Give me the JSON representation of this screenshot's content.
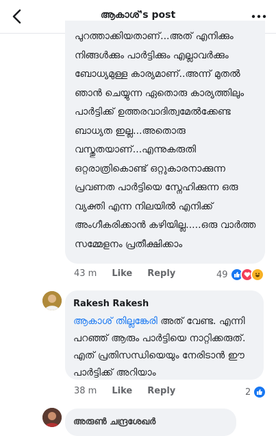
{
  "header": {
    "title": "ആകാശ്'s post"
  },
  "comments": [
    {
      "text": "പുറത്താക്കിയതാണ്...അത് എനിക്കും നിങ്ങൾക്കും പാർട്ടിക്കും എല്ലാവർക്കും ബോധ്യമുള്ള കാര്യമാണ്..അന്ന് മുതൽ ഞാൻ ചെയ്യുന്ന ഏതൊരു കാര്യത്തിലും പാർട്ടിക്ക് ഉത്തരവാദിത്വമേൽക്കേണ്ട ബാധ്യത ഇല്ല...അതൊരു വസ്തുതയാണ്...എന്നുകരുതി ഒറ്റരാത്രികൊണ്ട് ഒറ്റുകാരനാക്കുന്ന പ്രവണത പാർട്ടിയെ സ്നേഹിക്കുന്ന ഒരു വ്യക്തി എന്ന നിലയിൽ എനിക്ക് അംഗീകരിക്കാൻ കഴിയില്ല.....ഒരു വാർത്ത സമ്മേളനം പ്രതീക്ഷിക്കാം",
      "time": "43 m",
      "like_label": "Like",
      "reply_label": "Reply",
      "reaction_count": "49"
    },
    {
      "author": "Rakesh Rakesh",
      "tag": "ആകാശ് തില്ലങ്കേരി",
      "text": " അത് വേണ്ട. എന്നി  പറഞ്ഞ് ആരും പാർട്ടിയെ നാറ്റിക്കരുത്. എത് പ്രതിസന്ധിയെയും നേരിടാൻ ഈ പാർട്ടിക്ക് അറിയാം",
      "time": "38 m",
      "like_label": "Like",
      "reply_label": "Reply",
      "reaction_count": "2"
    },
    {
      "author": "അരുൺ ചന്ദ്രശേഖർ"
    }
  ]
}
